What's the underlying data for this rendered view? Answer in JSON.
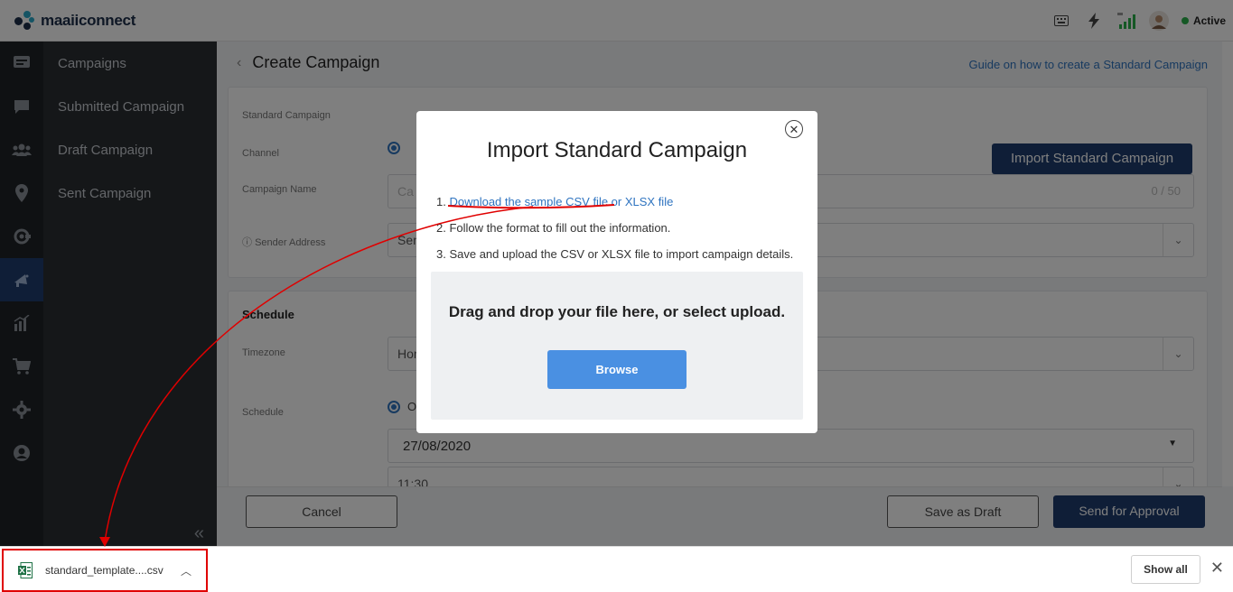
{
  "app": {
    "brand": "maaiiconnect",
    "status": "Active"
  },
  "sidebar": {
    "items": [
      {
        "label": "Campaigns"
      },
      {
        "label": "Submitted Campaign"
      },
      {
        "label": "Draft Campaign"
      },
      {
        "label": "Sent Campaign"
      }
    ]
  },
  "page": {
    "title": "Create Campaign",
    "guide_link": "Guide on how to create a Standard Campaign",
    "import_button": "Import Standard Campaign",
    "labels": {
      "standard_campaign": "Standard Campaign",
      "channel": "Channel",
      "campaign_name": "Campaign Name",
      "sender_address": "Sender Address",
      "schedule_section": "Schedule",
      "timezone": "Timezone",
      "schedule": "Schedule"
    },
    "campaign_name_placeholder": "Ca",
    "campaign_name_counter": "0 / 50",
    "sender_value": "Sen",
    "timezone_value": "Hon",
    "schedule_option": "O",
    "date_value": "27/08/2020",
    "time_value": "11:30"
  },
  "footer": {
    "cancel": "Cancel",
    "save_draft": "Save as Draft",
    "send_approval": "Send for Approval"
  },
  "modal": {
    "title": "Import Standard Campaign",
    "step1_prefix": "1. ",
    "step1_link": "Download the sample CSV file",
    "step1_link2": " or XLSX file",
    "step2": "2. Follow the format to fill out the information.",
    "step3": "3. Save and upload the CSV or XLSX file to import campaign details.",
    "drop_text": "Drag and drop your file here, or select upload.",
    "browse": "Browse"
  },
  "download_bar": {
    "file_name": "standard_template....csv",
    "show_all": "Show all"
  },
  "colors": {
    "brand_dark": "#1e3d6e",
    "link": "#2f74c0",
    "browse": "#4a90e2",
    "annotation": "#e00000",
    "active_status": "#2bb14b"
  }
}
